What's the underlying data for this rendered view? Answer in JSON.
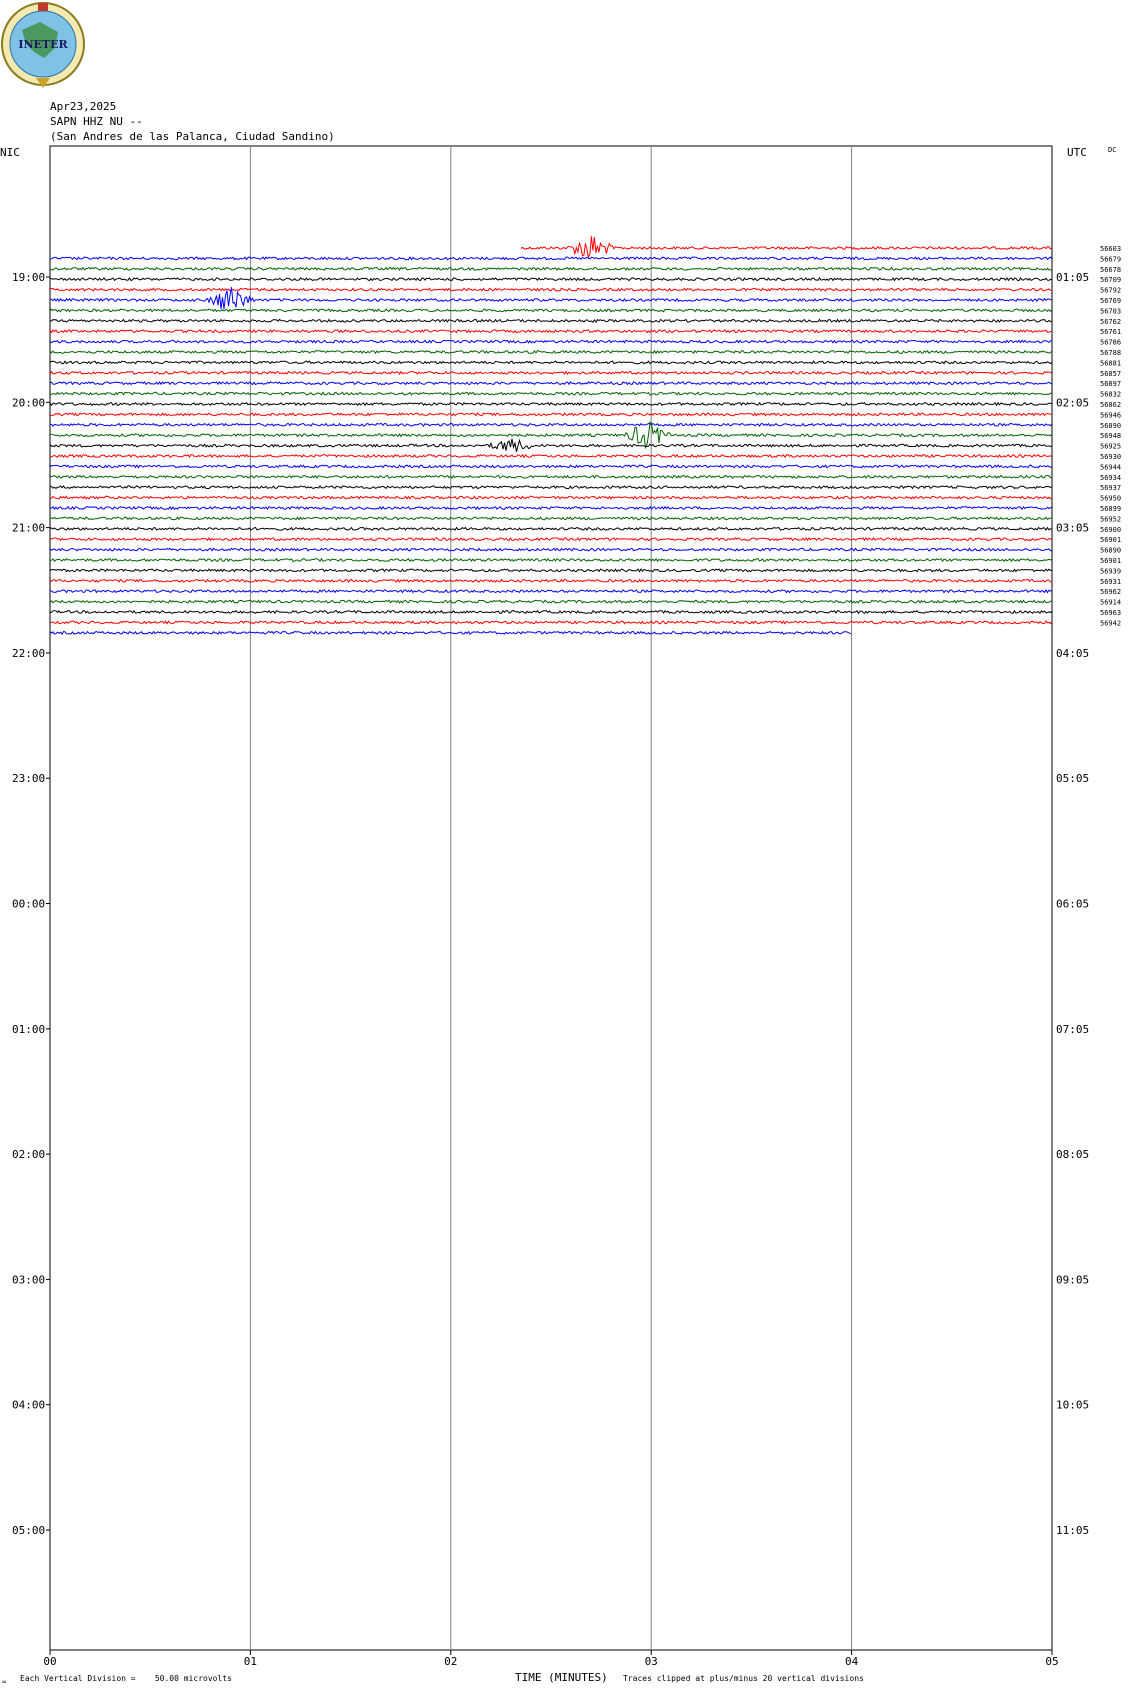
{
  "logo": {
    "text": "INETER"
  },
  "header": {
    "date": "Apr23,2025",
    "station": "SAPN HHZ NU --",
    "location": "(San Andres de las Palanca, Ciudad Sandino)"
  },
  "axis_labels": {
    "left": "NIC",
    "right": "UTC",
    "corner": "DC"
  },
  "footer": {
    "scale_note": "Each Vertical Division =    50.00 microvolts",
    "xlabel": "TIME (MINUTES)",
    "clip_note": "Traces clipped at plus/minus 20 vertical divisions"
  },
  "colors": {
    "red": "#ff0000",
    "blue": "#0000ff",
    "green": "#006400",
    "black": "#000000",
    "grid": "#808080"
  },
  "chart_data": {
    "type": "line",
    "xlabel": "TIME (MINUTES)",
    "xlim": [
      0,
      5
    ],
    "x_ticks": [
      "00",
      "01",
      "02",
      "03",
      "04",
      "05"
    ],
    "left_hour_labels": [
      "19:00",
      "20:00",
      "21:00",
      "22:00",
      "23:00",
      "00:00",
      "01:00",
      "02:00",
      "03:00",
      "04:00",
      "05:00"
    ],
    "right_hour_labels": [
      "01:05",
      "02:05",
      "03:05",
      "04:05",
      "05:05",
      "06:05",
      "07:05",
      "08:05",
      "09:05",
      "10:05",
      "11:05"
    ],
    "color_cycle": [
      "red",
      "blue",
      "green",
      "black"
    ],
    "first_row_start_minute": 2.35,
    "last_row_end_minute": 4.0,
    "rows": [
      {
        "label": "56603",
        "color": "red"
      },
      {
        "label": "56679",
        "color": "blue"
      },
      {
        "label": "56678",
        "color": "green"
      },
      {
        "label": "56709",
        "color": "black"
      },
      {
        "label": "56792",
        "color": "red"
      },
      {
        "label": "56769",
        "color": "blue"
      },
      {
        "label": "56703",
        "color": "green"
      },
      {
        "label": "56762",
        "color": "black"
      },
      {
        "label": "56761",
        "color": "red"
      },
      {
        "label": "56786",
        "color": "blue"
      },
      {
        "label": "56788",
        "color": "green"
      },
      {
        "label": "56881",
        "color": "black"
      },
      {
        "label": "56857",
        "color": "red"
      },
      {
        "label": "56897",
        "color": "blue"
      },
      {
        "label": "56832",
        "color": "green"
      },
      {
        "label": "56862",
        "color": "black"
      },
      {
        "label": "56946",
        "color": "red"
      },
      {
        "label": "56890",
        "color": "blue"
      },
      {
        "label": "56948",
        "color": "green"
      },
      {
        "label": "56925",
        "color": "black"
      },
      {
        "label": "56930",
        "color": "red"
      },
      {
        "label": "56944",
        "color": "blue"
      },
      {
        "label": "56934",
        "color": "green"
      },
      {
        "label": "56937",
        "color": "black"
      },
      {
        "label": "56950",
        "color": "red"
      },
      {
        "label": "56899",
        "color": "blue"
      },
      {
        "label": "56952",
        "color": "green"
      },
      {
        "label": "56900",
        "color": "black"
      },
      {
        "label": "56901",
        "color": "red"
      },
      {
        "label": "56890",
        "color": "blue"
      },
      {
        "label": "56901",
        "color": "green"
      },
      {
        "label": "56939",
        "color": "black"
      },
      {
        "label": "56931",
        "color": "red"
      },
      {
        "label": "56962",
        "color": "blue"
      },
      {
        "label": "56914",
        "color": "green"
      },
      {
        "label": "56963",
        "color": "black"
      },
      {
        "label": "56942",
        "color": "red"
      },
      {
        "label": "",
        "color": "blue"
      }
    ],
    "notable_events": [
      {
        "row": 0,
        "minute": 2.7,
        "color": "red",
        "amplitude": "large"
      },
      {
        "row": 5,
        "minute": 0.9,
        "color": "blue",
        "amplitude": "large"
      },
      {
        "row": 18,
        "minute": 2.98,
        "color": "green",
        "amplitude": "large"
      },
      {
        "row": 19,
        "minute": 2.3,
        "color": "black",
        "amplitude": "medium"
      }
    ]
  }
}
